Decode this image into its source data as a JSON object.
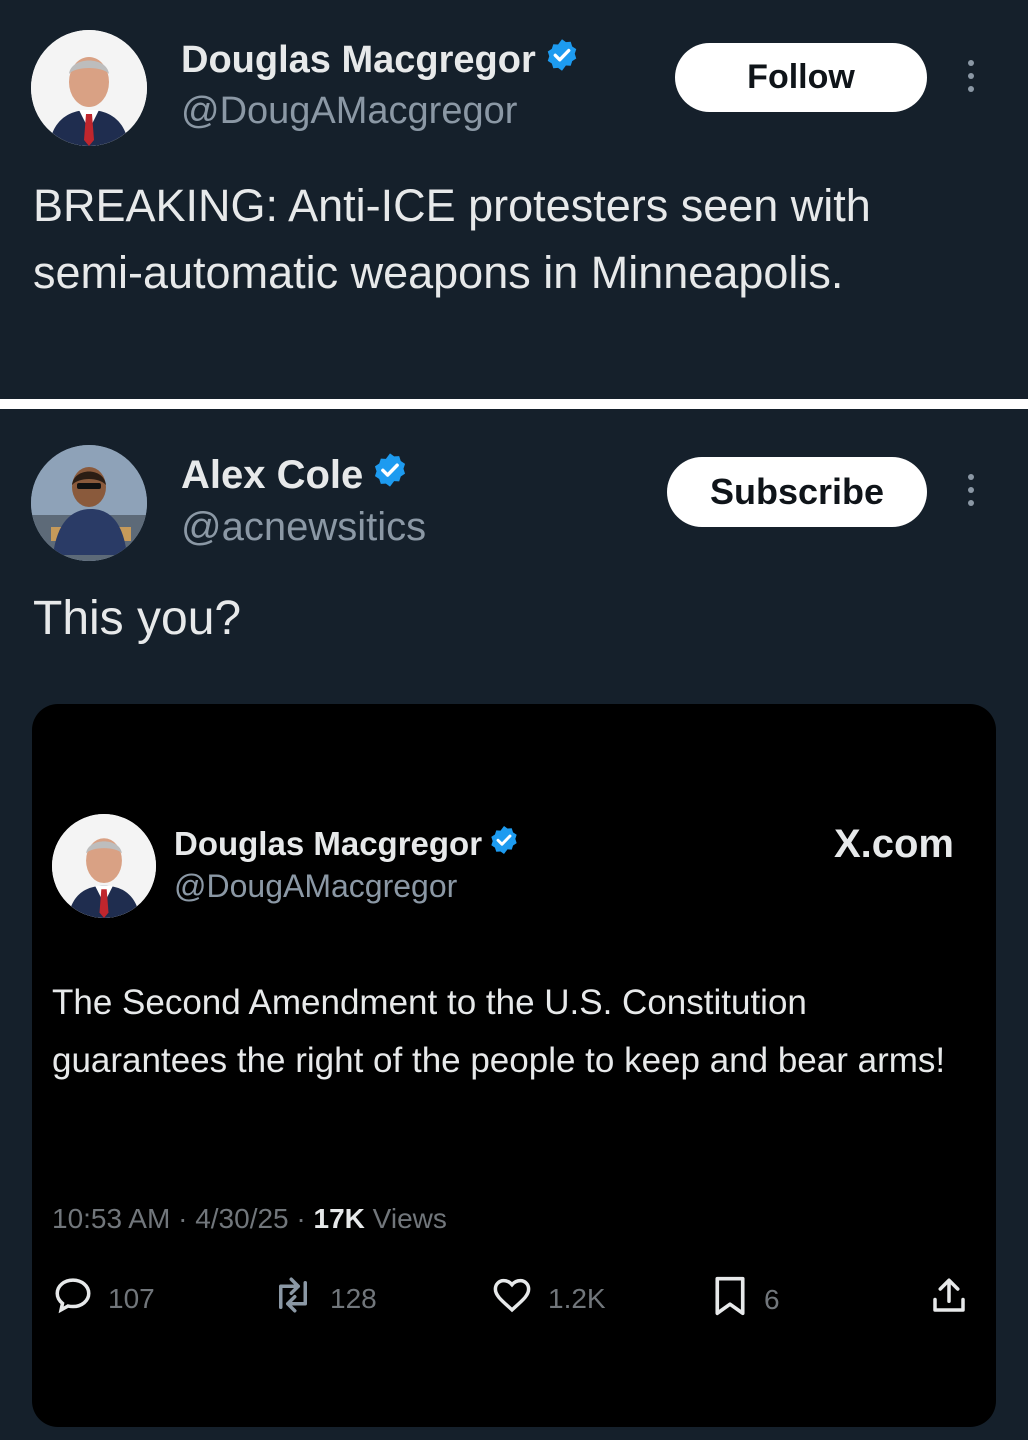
{
  "tweet_top": {
    "name": "Douglas Macgregor",
    "handle": "@DougAMacgregor",
    "button_label": "Follow",
    "text": "BREAKING: Anti-ICE protesters seen with semi-automatic weapons in Minneapolis."
  },
  "tweet_reply": {
    "name": "Alex Cole",
    "handle": "@acnewsitics",
    "button_label": "Subscribe",
    "text": "This you?"
  },
  "quoted": {
    "name": "Douglas Macgregor",
    "handle": "@DougAMacgregor",
    "source": "X.com",
    "text": "The Second Amendment to the U.S. Constitution guarantees the right of the people to keep and bear arms!",
    "time": "10:53 AM",
    "date": "4/30/25",
    "views_count": "17K",
    "views_label": "Views",
    "replies": "107",
    "reposts": "128",
    "likes": "1.2K",
    "bookmarks": "6"
  },
  "colors": {
    "background": "#15202b",
    "card": "#000000",
    "verified": "#1d9bf0",
    "muted": "#8b98a5"
  },
  "icons": [
    "verified-badge-icon",
    "more-options-icon",
    "reply-icon",
    "repost-icon",
    "like-icon",
    "bookmark-icon",
    "share-icon"
  ]
}
